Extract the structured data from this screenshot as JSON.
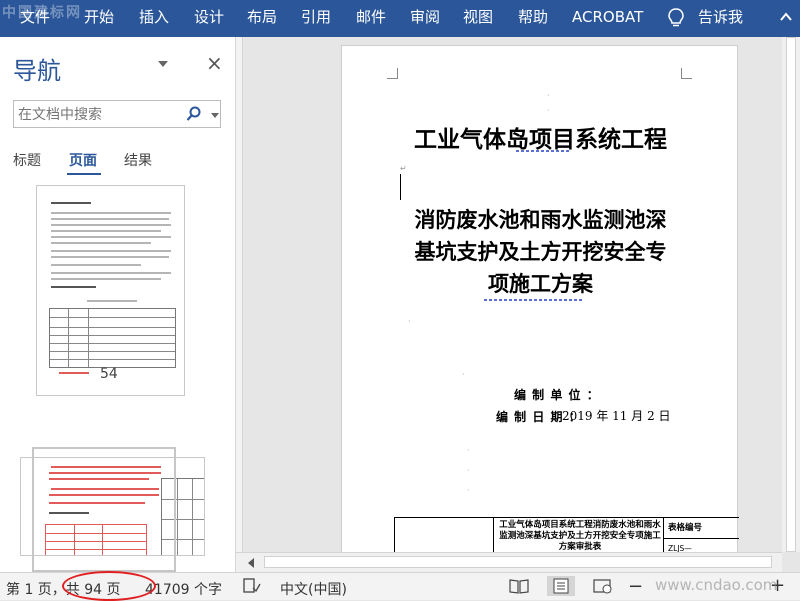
{
  "ribbon": {
    "tabs": [
      "文件",
      "开始",
      "插入",
      "设计",
      "布局",
      "引用",
      "邮件",
      "审阅",
      "视图",
      "帮助",
      "ACROBAT"
    ],
    "tell_me": "告诉我",
    "bulb_icon": "lightbulb-icon",
    "bg_color": "#2b579a"
  },
  "watermark_top": "中国建标网",
  "nav": {
    "title": "导航",
    "search_placeholder": "在文档中搜索",
    "tabs": [
      "标题",
      "页面",
      "结果"
    ],
    "active_tab": "页面",
    "page_label": "54"
  },
  "doc": {
    "title": "工业气体岛项目系统工程",
    "subtitle_lines": [
      "消防废水池和雨水监测池深",
      "基坑支护及土方开挖安全专",
      "项施工方案"
    ],
    "unit_label": "编 制 单 位 ：",
    "date_label": "编 制 日 期 ：",
    "date_value": "2019 年 11 月 2 日",
    "table": {
      "main_text": "工业气体岛项目系统工程消防废水池和雨水监测池深基坑支护及土方开挖安全专项施工方案审批表",
      "right_top": "表格编号",
      "right_bottom": "ZLJS—"
    }
  },
  "status": {
    "page": "第 1 页，共 94 页",
    "words": "41709 个字",
    "language": "中文(中国)",
    "zoom_minus": "−",
    "zoom_plus": "+"
  },
  "watermark_bottom": "www.cndao.com"
}
